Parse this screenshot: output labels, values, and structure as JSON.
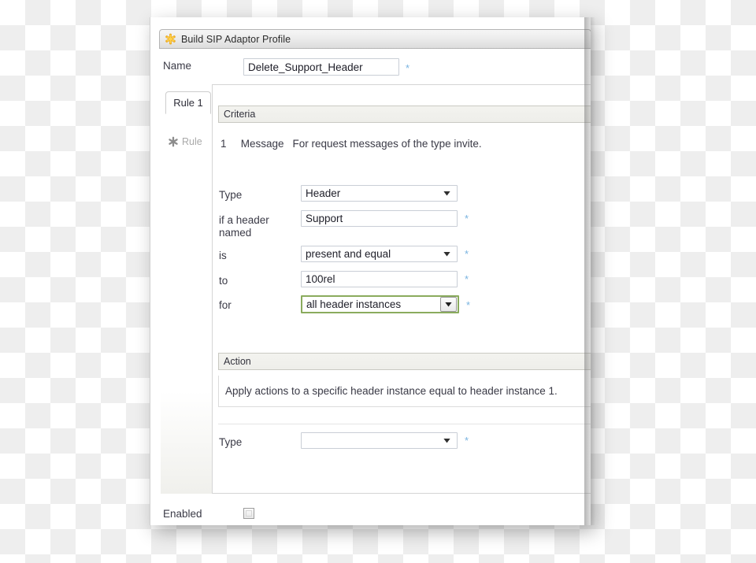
{
  "window": {
    "title": "Build SIP Adaptor Profile",
    "title_icon": "asterisk-star-icon"
  },
  "name_field": {
    "label": "Name",
    "value": "Delete_Support_Header",
    "placeholder": "",
    "required_marker": "*"
  },
  "sidebar": {
    "active_tab": "Rule 1",
    "items": [
      {
        "label": "Rule",
        "icon": "asterisk-icon"
      }
    ]
  },
  "criteria": {
    "header": "Criteria",
    "summary": {
      "index": "1",
      "kind": "Message",
      "description": "For request messages of the type invite."
    },
    "fields": [
      {
        "label": "Type",
        "control": "select",
        "value": "Header",
        "required_marker": "",
        "focused": false
      },
      {
        "label": "if a header named",
        "control": "text",
        "value": "Support",
        "placeholder": "",
        "required_marker": "*",
        "focused": false
      },
      {
        "label": "is",
        "control": "select",
        "value": "present and equal",
        "required_marker": "*",
        "focused": false
      },
      {
        "label": "to",
        "control": "text",
        "value": "100rel",
        "placeholder": "",
        "required_marker": "*",
        "focused": false
      },
      {
        "label": "for",
        "control": "select",
        "value": "all header instances",
        "required_marker": "*",
        "focused": true
      }
    ]
  },
  "action": {
    "header": "Action",
    "description": "Apply actions to a specific header instance equal to header instance 1.",
    "fields": [
      {
        "label": "Type",
        "control": "select",
        "value": "",
        "required_marker": "*",
        "focused": false
      }
    ]
  },
  "footer": {
    "enabled_label": "Enabled",
    "enabled_checked": false
  },
  "colors": {
    "focus_border": "#8aab5d",
    "required_marker": "#79b3e0",
    "title_icon": "#f2b32e"
  }
}
